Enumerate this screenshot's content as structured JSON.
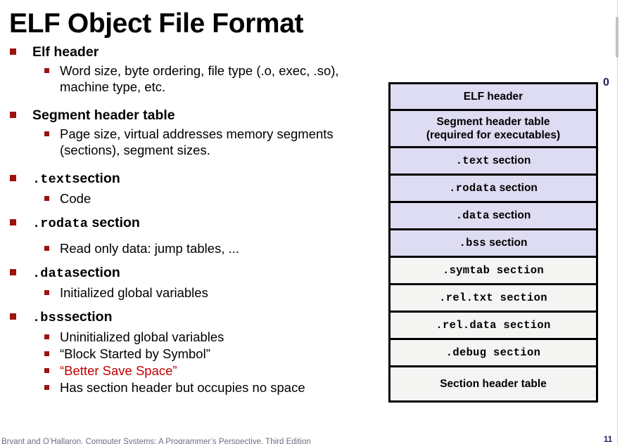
{
  "slide": {
    "title": "ELF Object File Format",
    "accent_bullet_color": "#9C1111",
    "highlight_text_color": "#C00000",
    "box_fill_primary": "#DDDCF2",
    "box_fill_secondary": "#F4F4F3",
    "box_border_color": "#000000"
  },
  "bullets": [
    {
      "level": 1,
      "mono": "",
      "text": "Elf header",
      "children": [
        {
          "level": 2,
          "text": "Word size, byte ordering, file type (.o, exec, .so), machine type, etc."
        }
      ]
    },
    {
      "level": 1,
      "mono": "",
      "text": "Segment header table",
      "children": [
        {
          "level": 2,
          "text": "Page size, virtual addresses memory segments (sections), segment sizes."
        }
      ]
    },
    {
      "level": 1,
      "mono": ".text",
      "text": "section",
      "children": [
        {
          "level": 2,
          "text": "Code"
        }
      ]
    },
    {
      "level": 1,
      "mono": ".rodata",
      "text": "section",
      "children": [
        {
          "level": 2,
          "text": "Read only data: jump tables, ..."
        }
      ]
    },
    {
      "level": 1,
      "mono": ".data",
      "text": "section",
      "children": [
        {
          "level": 2,
          "text": "Initialized global variables"
        }
      ]
    },
    {
      "level": 1,
      "mono": ".bss",
      "text": "section",
      "children": [
        {
          "level": 2,
          "text": "Uninitialized global variables"
        },
        {
          "level": 2,
          "text": "“Block Started by Symbol”"
        },
        {
          "level": 2,
          "text": "“Better Save Space”",
          "color": "#C00000"
        },
        {
          "level": 2,
          "text": "Has section header but occupies no space"
        }
      ]
    }
  ],
  "diagram": {
    "address_label": "0",
    "rows": [
      {
        "label": "ELF header",
        "style": "sans",
        "fill": "primary"
      },
      {
        "label_line1": "Segment header table",
        "label_line2": "(required for executables)",
        "style": "sans",
        "fill": "primary"
      },
      {
        "label_mono": ".text",
        "label": "section",
        "style": "mono-sans",
        "fill": "primary"
      },
      {
        "label_mono": ".rodata",
        "label": "section",
        "style": "mono-sans",
        "fill": "primary"
      },
      {
        "label_mono": ".data",
        "label": "section",
        "style": "mono-sans",
        "fill": "primary"
      },
      {
        "label_mono": ".bss",
        "label": "section",
        "style": "mono-sans",
        "fill": "primary"
      },
      {
        "label_mono": ".symtab",
        "label": "section",
        "style": "mono",
        "fill": "secondary"
      },
      {
        "label_mono": ".rel.txt",
        "label": "section",
        "style": "mono",
        "fill": "secondary"
      },
      {
        "label_mono": ".rel.data",
        "label": "section",
        "style": "mono",
        "fill": "secondary"
      },
      {
        "label_mono": ".debug",
        "label": "section",
        "style": "mono",
        "fill": "secondary"
      },
      {
        "label": "Section header table",
        "style": "sans",
        "fill": "secondary"
      }
    ]
  },
  "footer": {
    "text": "Bryant and O’Hallaron, Computer Systems: A Programmer’s Perspective, Third Edition",
    "page": "11"
  }
}
